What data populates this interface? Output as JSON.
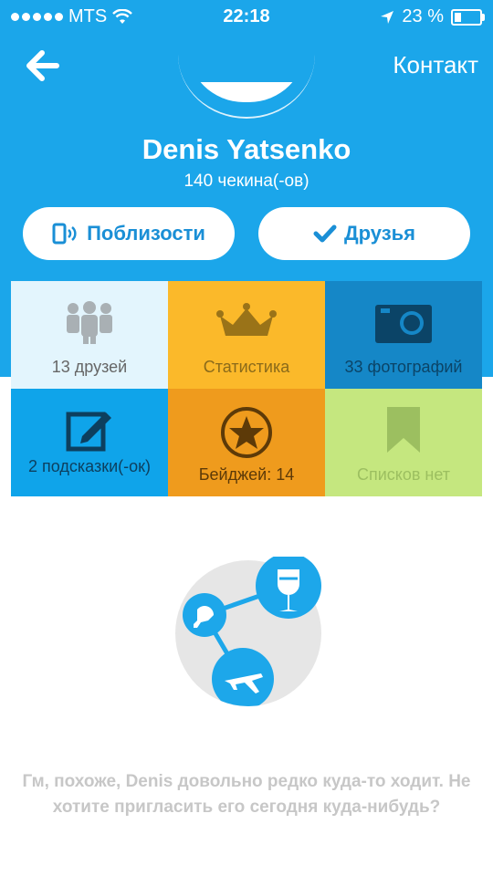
{
  "status_bar": {
    "carrier": "MTS",
    "time": "22:18",
    "battery_text": "23 %",
    "signal_icon": "signal-dots-icon",
    "wifi_icon": "wifi-icon",
    "location_icon": "location-arrow-icon",
    "battery_level": 0.23
  },
  "nav": {
    "back_icon": "arrow-left-icon",
    "contact_label": "Контакт"
  },
  "profile": {
    "name": "Denis Yatsenko",
    "checkins": "140 чекина(-ов)"
  },
  "buttons": {
    "nearby_label": "Поблизости",
    "friends_label": "Друзья"
  },
  "tiles": [
    {
      "label": "13 друзей",
      "icon": "people-icon"
    },
    {
      "label": "Статистика",
      "icon": "crown-icon"
    },
    {
      "label": "33 фотографий",
      "icon": "camera-icon"
    },
    {
      "label": "2 подсказки(-ок)",
      "icon": "edit-icon"
    },
    {
      "label": "Бейджей: 14",
      "icon": "star-badge-icon"
    },
    {
      "label": "Списков нет",
      "icon": "bookmark-icon"
    }
  ],
  "empty_state": {
    "message": "Гм, похоже, Denis довольно редко куда-то ходит. Не хотите пригласить его сегодня куда-нибудь?"
  },
  "colors": {
    "header_blue": "#1ba6ea",
    "tile_friends": "#e3f5fd",
    "tile_stats": "#fbb92a",
    "tile_photos": "#1587c7",
    "tile_tips": "#0fa4ea",
    "tile_badges": "#ef9b1d",
    "tile_lists": "#c5e77f"
  }
}
